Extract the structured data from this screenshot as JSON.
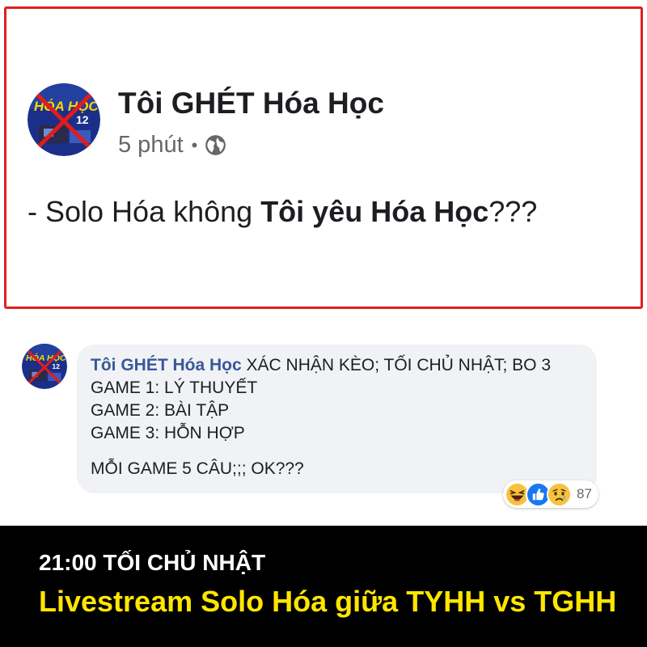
{
  "post": {
    "author": "Tôi GHÉT Hóa Học",
    "time": "5 phút",
    "separator": "•",
    "text_prefix": "- Solo Hóa không ",
    "text_bold": "Tôi yêu Hóa Học",
    "text_suffix": "???",
    "avatar_text_main": "HÓA HỌC",
    "avatar_text_num": "12"
  },
  "comment": {
    "author": "Tôi GHÉT Hóa Học",
    "first_line": " XÁC NHẬN KÈO; TỐI CHỦ NHẬT; BO 3",
    "lines": [
      "GAME 1: LÝ THUYẾT",
      "GAME 2: BÀI TẬP",
      "GAME 3: HỖN HỢP"
    ],
    "last_line": "MỖI GAME 5 CÂU;;; OK???",
    "reactions": [
      "haha-icon",
      "like-icon",
      "sad-icon"
    ],
    "reaction_count": "87"
  },
  "banner": {
    "line1": "21:00 TỐI CHỦ NHẬT",
    "line2": "Livestream Solo Hóa giữa TYHH vs TGHH"
  },
  "colors": {
    "frame": "#e02020",
    "author_link": "#385898",
    "banner_bg": "#000000",
    "banner_highlight": "#ffe600"
  }
}
